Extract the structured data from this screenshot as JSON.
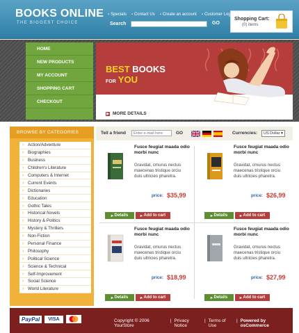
{
  "header": {
    "logo": "BOOKS ONLINE",
    "tagline": "THE BIGGEST CHOICE",
    "links": [
      "Specials",
      "Contact Us",
      "Create an account",
      "Customer Login"
    ],
    "search_label": "Search",
    "search_go": "GO",
    "cart_title": "Shopping Cart:",
    "cart_items": "(0) items"
  },
  "nav": {
    "items": [
      "HOME",
      "NEW PRODUCTS",
      "MY ACCOUNT",
      "SHOPPING CART",
      "CHECKOUT"
    ]
  },
  "banner": {
    "best": "BEST",
    "books": "BOOKS",
    "for": "FOR",
    "you": "YOU",
    "more": "MORE DETAILS"
  },
  "sidebar": {
    "heading": "BROWSE BY CATEGORIES",
    "categories": [
      "Action/Adventure",
      "Biographies",
      "Business",
      "Children's Literature",
      "Computers & Internet",
      "Current Events",
      "Dictionaries",
      "Education",
      "Gothic Tales",
      "Historical Novels",
      "History & Politics",
      "Mystery & Thrillers",
      "Non-Fiction",
      "Personal Finance",
      "Philosophy",
      "Political Science",
      "Science & Technical",
      "Self-Improvement",
      "Social Science",
      "World Literature"
    ]
  },
  "tellbar": {
    "label": "Tell a friend",
    "input_placeholder": "Enter e-mail here",
    "go": "GO",
    "currencies_label": "Currencies:",
    "currency": "US Dollar"
  },
  "products": [
    {
      "title": "Fusce feugiat maada odio morbi nunc",
      "desc": "Gravidat, cmurus nectus maecenas tristique orciu duis ultricies pharetra.",
      "price_label": "price:",
      "price": "$35,99",
      "details": "Details",
      "add": "Add to cart",
      "book_color": "#3c6b3a"
    },
    {
      "title": "Fusce feugiat maada odio morbi nunc",
      "desc": "Gravidat, cmurus nectus maecenas tristique orciu duis ultricies pharetra.",
      "price_label": "price:",
      "price": "$26,99",
      "details": "Details",
      "add": "Add to cart",
      "book_color": "#d99a1e"
    },
    {
      "title": "Fusce feugiat maada odio morbi nunc",
      "desc": "Gravidat, cmurus nectus maecenas tristique orciu duis ultricies pharetra.",
      "price_label": "price:",
      "price": "$18,99",
      "details": "Details",
      "add": "Add to cart",
      "book_color": "#e9e6df"
    },
    {
      "title": "Fusce feugiat maada odio morbi nunc",
      "desc": "Gravidat, cmurus nectus maecenas tristique orciu duis ultricies pharetra.",
      "price_label": "price:",
      "price": "$27,99",
      "details": "Details",
      "add": "Add to cart",
      "book_color": "#9fa7ad"
    }
  ],
  "footer": {
    "paypal": "PayPal",
    "visa": "VISA",
    "copyright": "Copyright © 2006 YourStore",
    "privacy": "Privacy Notice",
    "terms": "Terms of Use",
    "powered": "Powered by osCommerce"
  }
}
